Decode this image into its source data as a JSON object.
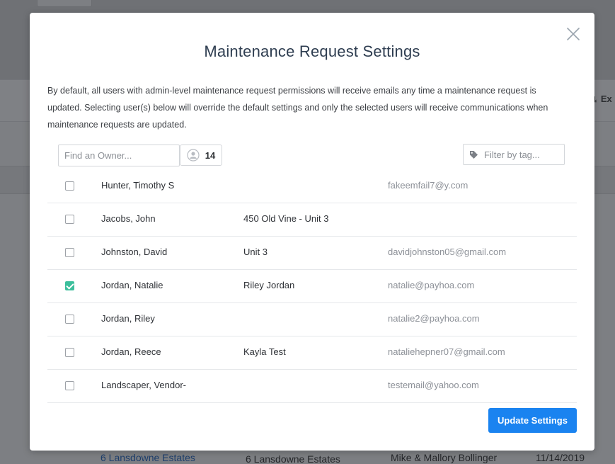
{
  "background": {
    "export_label": "Ex",
    "footer": {
      "link": "6 Lansdowne Estates",
      "address": "6 Lansdowne Estates",
      "owners": "Mike & Mallory Bollinger",
      "date": "11/14/2019"
    }
  },
  "modal": {
    "title": "Maintenance Request Settings",
    "description": "By default, all users with admin-level maintenance request permissions will receive emails any time a maintenance request is updated. Selecting user(s) below will override the default settings and only the selected users will receive communications when maintenance requests are updated.",
    "owner_search": {
      "placeholder": "Find an Owner..."
    },
    "owner_count": "14",
    "tag_filter": {
      "placeholder": "Filter by tag..."
    },
    "owners": [
      {
        "name": "Hunter, Timothy S",
        "unit": "",
        "email": "fakeemfail7@y.com",
        "checked": false
      },
      {
        "name": "Jacobs, John",
        "unit": "450 Old Vine - Unit 3",
        "email": "",
        "checked": false
      },
      {
        "name": "Johnston, David",
        "unit": "Unit 3",
        "email": "davidjohnston05@gmail.com",
        "checked": false
      },
      {
        "name": "Jordan, Natalie",
        "unit": "Riley Jordan",
        "email": "natalie@payhoa.com",
        "checked": true
      },
      {
        "name": "Jordan, Riley",
        "unit": "",
        "email": "natalie2@payhoa.com",
        "checked": false
      },
      {
        "name": "Jordan, Reece",
        "unit": "Kayla Test",
        "email": "nataliehepner07@gmail.com",
        "checked": false
      },
      {
        "name": "Landscaper, Vendor-",
        "unit": "",
        "email": "testemail@yahoo.com",
        "checked": false
      }
    ],
    "update_button": "Update Settings"
  },
  "colors": {
    "accent": "#1a83f0",
    "checked": "#3cbf9c",
    "title": "#2f3e51"
  },
  "icons": {
    "close": "close-icon",
    "user": "user-circle-icon",
    "tag": "tag-icon"
  }
}
